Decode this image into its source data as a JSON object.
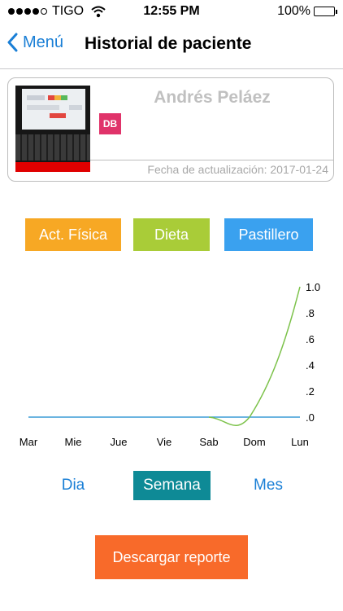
{
  "status_bar": {
    "carrier": "TIGO",
    "time": "12:55 PM",
    "battery": "100%"
  },
  "nav": {
    "back_label": "Menú",
    "title": "Historial de paciente"
  },
  "patient": {
    "name": "Andrés Peláez",
    "initials": "DB",
    "initials_color": "#e0336a",
    "update_text": "Fecha de actualización: 2017-01-24"
  },
  "categories": {
    "activity": {
      "label": "Act. Física",
      "color": "#f7a824"
    },
    "diet": {
      "label": "Dieta",
      "color": "#a9cc38"
    },
    "pills": {
      "label": "Pastillero",
      "color": "#3aa1ef"
    }
  },
  "chart_data": {
    "type": "line",
    "categories": [
      "Mar",
      "Mie",
      "Jue",
      "Vie",
      "Sab",
      "Dom",
      "Lun"
    ],
    "y_ticks": [
      "1.0",
      ".8",
      ".6",
      ".4",
      ".2",
      ".0"
    ],
    "ylim": [
      0,
      1
    ],
    "series": [
      {
        "values": [
          0,
          0,
          0,
          0,
          0,
          0,
          0
        ],
        "color": "#3a9bd5"
      },
      {
        "values": [
          0,
          0,
          0,
          0,
          0,
          0,
          1
        ],
        "color": "#7cc24a"
      }
    ]
  },
  "periods": {
    "day": "Dia",
    "week": "Semana",
    "month": "Mes",
    "selected_color": "#0e8a96"
  },
  "download": {
    "label": "Descargar reporte",
    "color": "#f86a2a"
  }
}
